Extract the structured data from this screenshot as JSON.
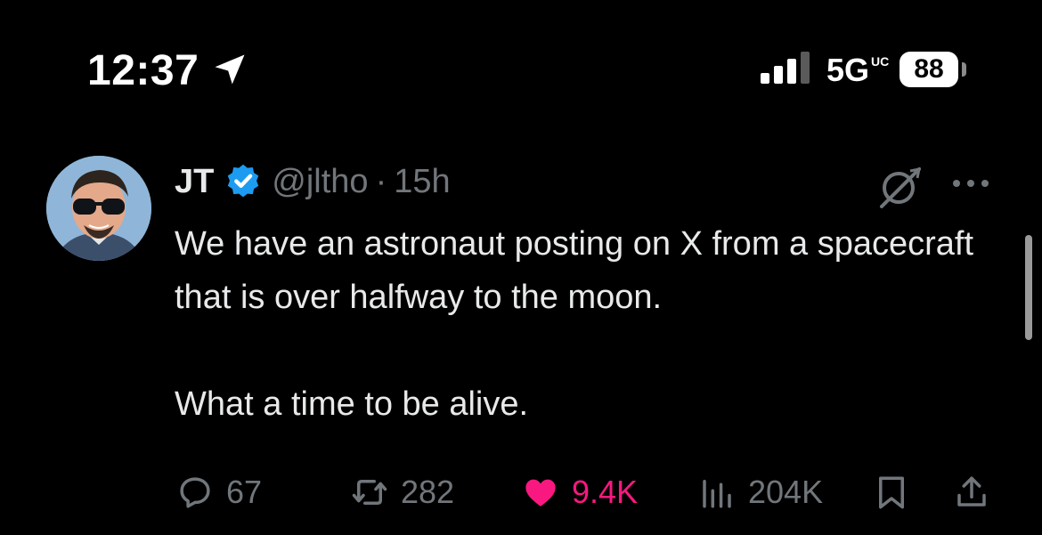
{
  "status_bar": {
    "time": "12:37",
    "network": "5G",
    "network_suffix": "UC",
    "battery": "88"
  },
  "tweet": {
    "author_name": "JT",
    "handle": "@jltho",
    "separator": "·",
    "age": "15h",
    "text_line_1": "We have an astronaut posting on X from a spacecraft that is over halfway to the moon.",
    "text_line_2": "What a time to be alive.",
    "actions": {
      "replies": "67",
      "reposts": "282",
      "likes": "9.4K",
      "views": "204K"
    },
    "colors": {
      "like": "#f91880",
      "verified": "#1d9bf0",
      "muted": "#71767b"
    },
    "icons": [
      "location-arrow-icon",
      "signal-icon",
      "verified-badge-icon",
      "grok-icon",
      "more-icon",
      "reply-icon",
      "repost-icon",
      "like-icon",
      "views-icon",
      "bookmark-icon",
      "share-icon"
    ]
  }
}
